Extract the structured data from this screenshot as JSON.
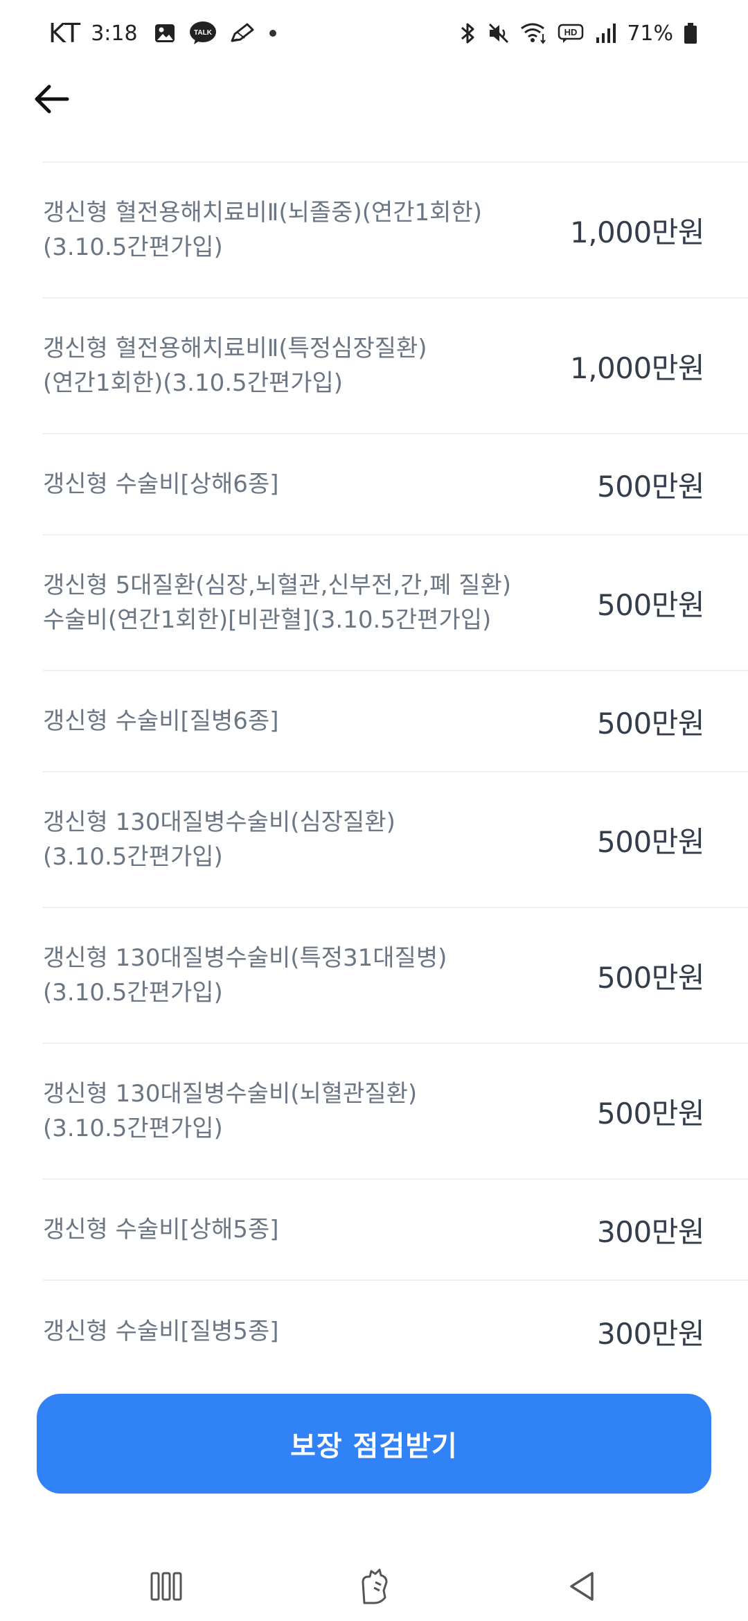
{
  "status_bar": {
    "carrier": "KT",
    "time": "3:18",
    "battery": "71%"
  },
  "list": {
    "items": [
      {
        "label": "갱신형 혈전용해치료비Ⅱ(뇌졸중)(연간1회한)\n(3.10.5간편가입)",
        "amount": "1,000만원"
      },
      {
        "label": "갱신형 혈전용해치료비Ⅱ(특정심장질환)\n(연간1회한)(3.10.5간편가입)",
        "amount": "1,000만원"
      },
      {
        "label": "갱신형 수술비[상해6종]",
        "amount": "500만원"
      },
      {
        "label": "갱신형 5대질환(심장,뇌혈관,신부전,간,폐 질환)\n수술비(연간1회한)[비관혈](3.10.5간편가입)",
        "amount": "500만원"
      },
      {
        "label": "갱신형 수술비[질병6종]",
        "amount": "500만원"
      },
      {
        "label": "갱신형 130대질병수술비(심장질환)\n(3.10.5간편가입)",
        "amount": "500만원"
      },
      {
        "label": "갱신형 130대질병수술비(특정31대질병)\n(3.10.5간편가입)",
        "amount": "500만원"
      },
      {
        "label": "갱신형 130대질병수술비(뇌혈관질환)\n(3.10.5간편가입)",
        "amount": "500만원"
      },
      {
        "label": "갱신형 수술비[상해5종]",
        "amount": "300만원"
      },
      {
        "label": "갱신형 수술비[질병5종]",
        "amount": "300만원"
      }
    ]
  },
  "cta": {
    "label": "보장 점검받기"
  },
  "colors": {
    "accent": "#3182f6",
    "label_text": "#6b7684",
    "value_text": "#333d4b",
    "divider": "#eef0f3"
  }
}
